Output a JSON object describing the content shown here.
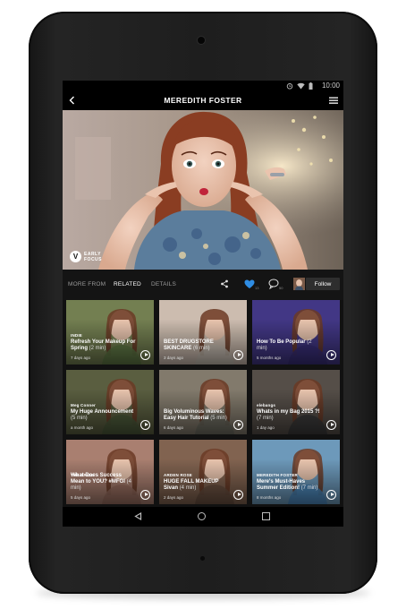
{
  "status": {
    "time": "10:00"
  },
  "appbar": {
    "title": "MEREDITH FOSTER"
  },
  "hero": {
    "brand": "EARLY FOCUS"
  },
  "tabs": {
    "more_from": "MORE FROM",
    "related": "RELATED",
    "details": "DETAILS",
    "heart_count": "13",
    "comment_count": "50",
    "follow": "Follow"
  },
  "videos": [
    {
      "tag": "INDIE",
      "title": "Refresh Your Makeup For Spring",
      "dur": "(2 min)",
      "age": "7 days ago",
      "colors": [
        "#5f7a45",
        "#b08f76"
      ]
    },
    {
      "tag": "",
      "title": "BEST DRUGSTORE SKINCARE",
      "dur": "(6 min)",
      "age": "3 days ago",
      "colors": [
        "#c9bfb4",
        "#d6b59e"
      ]
    },
    {
      "tag": "",
      "title": "How To Be Popular",
      "dur": "(2 min)",
      "age": "5 months ago",
      "colors": [
        "#3a2f7a",
        "#5a4ea6"
      ]
    },
    {
      "tag": "Meg Conner",
      "title": "My Huge Announcement",
      "dur": "(5 min)",
      "age": "a month ago",
      "colors": [
        "#4a5a3a",
        "#8a6b52"
      ]
    },
    {
      "tag": "",
      "title": "Big Voluminous Waves: Easy Hair Tutorial",
      "dur": "(5 min)",
      "age": "6 days ago",
      "colors": [
        "#6d6d62",
        "#c2a48a"
      ]
    },
    {
      "tag": "elebangs",
      "title": "Whats in my Bag 2015 ?!",
      "dur": "(7 min)",
      "age": "1 day ago",
      "colors": [
        "#3a3a3a",
        "#a88b72"
      ]
    },
    {
      "tag": "THE BRIDE",
      "title": "What Does Success Mean to YOU? #MFGI",
      "dur": "(4 min)",
      "age": "5 days ago",
      "colors": [
        "#9a6f60",
        "#d8b0a0"
      ]
    },
    {
      "tag": "ARDEN ROSE",
      "title": "HUGE FALL MAKEUP Sivan",
      "dur": "(4 min)",
      "age": "2 days ago",
      "colors": [
        "#6a5040",
        "#c89a7e"
      ]
    },
    {
      "tag": "MEREDITH FOSTER",
      "title": "Mere's Must-Haves Summer Edition!",
      "dur": "(7 min)",
      "age": "8 months ago",
      "colors": [
        "#4a8ac0",
        "#d8c6a8"
      ]
    }
  ]
}
